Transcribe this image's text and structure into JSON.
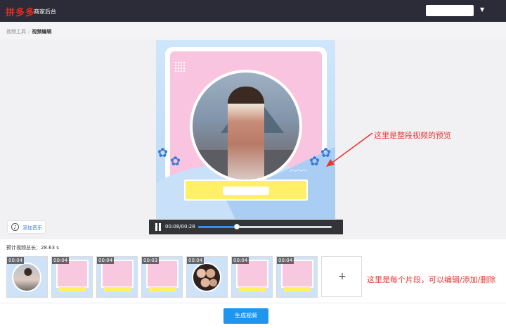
{
  "header": {
    "logo_text": "拼多多",
    "logo_subtitle": "商家后台"
  },
  "breadcrumb": {
    "items": [
      "视频工具",
      "视频编辑"
    ],
    "separator": "/"
  },
  "player": {
    "time": "00:08/00:28",
    "progress": 0.29
  },
  "music_button": {
    "label": "添加音乐"
  },
  "annotations": {
    "preview_note": "这里是整段视频的预览",
    "clips_note": "这里是每个片段，可以编辑/添加/删除"
  },
  "timeline": {
    "total_label": "预计视频总长：28.63 s",
    "clips": [
      {
        "duration": "00:04",
        "thumb": "person"
      },
      {
        "duration": "00:04",
        "thumb": "template"
      },
      {
        "duration": "00:04",
        "thumb": "template"
      },
      {
        "duration": "00:03",
        "thumb": "template"
      },
      {
        "duration": "00:04",
        "thumb": "faces"
      },
      {
        "duration": "00:04",
        "thumb": "template"
      },
      {
        "duration": "00:04",
        "thumb": "template"
      }
    ],
    "add_symbol": "+"
  },
  "footer": {
    "generate_label": "生成视频"
  },
  "colors": {
    "brand": "#e02e24",
    "accent": "#1e96f0",
    "annotation": "#e53935",
    "topbar": "#2c2c38"
  }
}
